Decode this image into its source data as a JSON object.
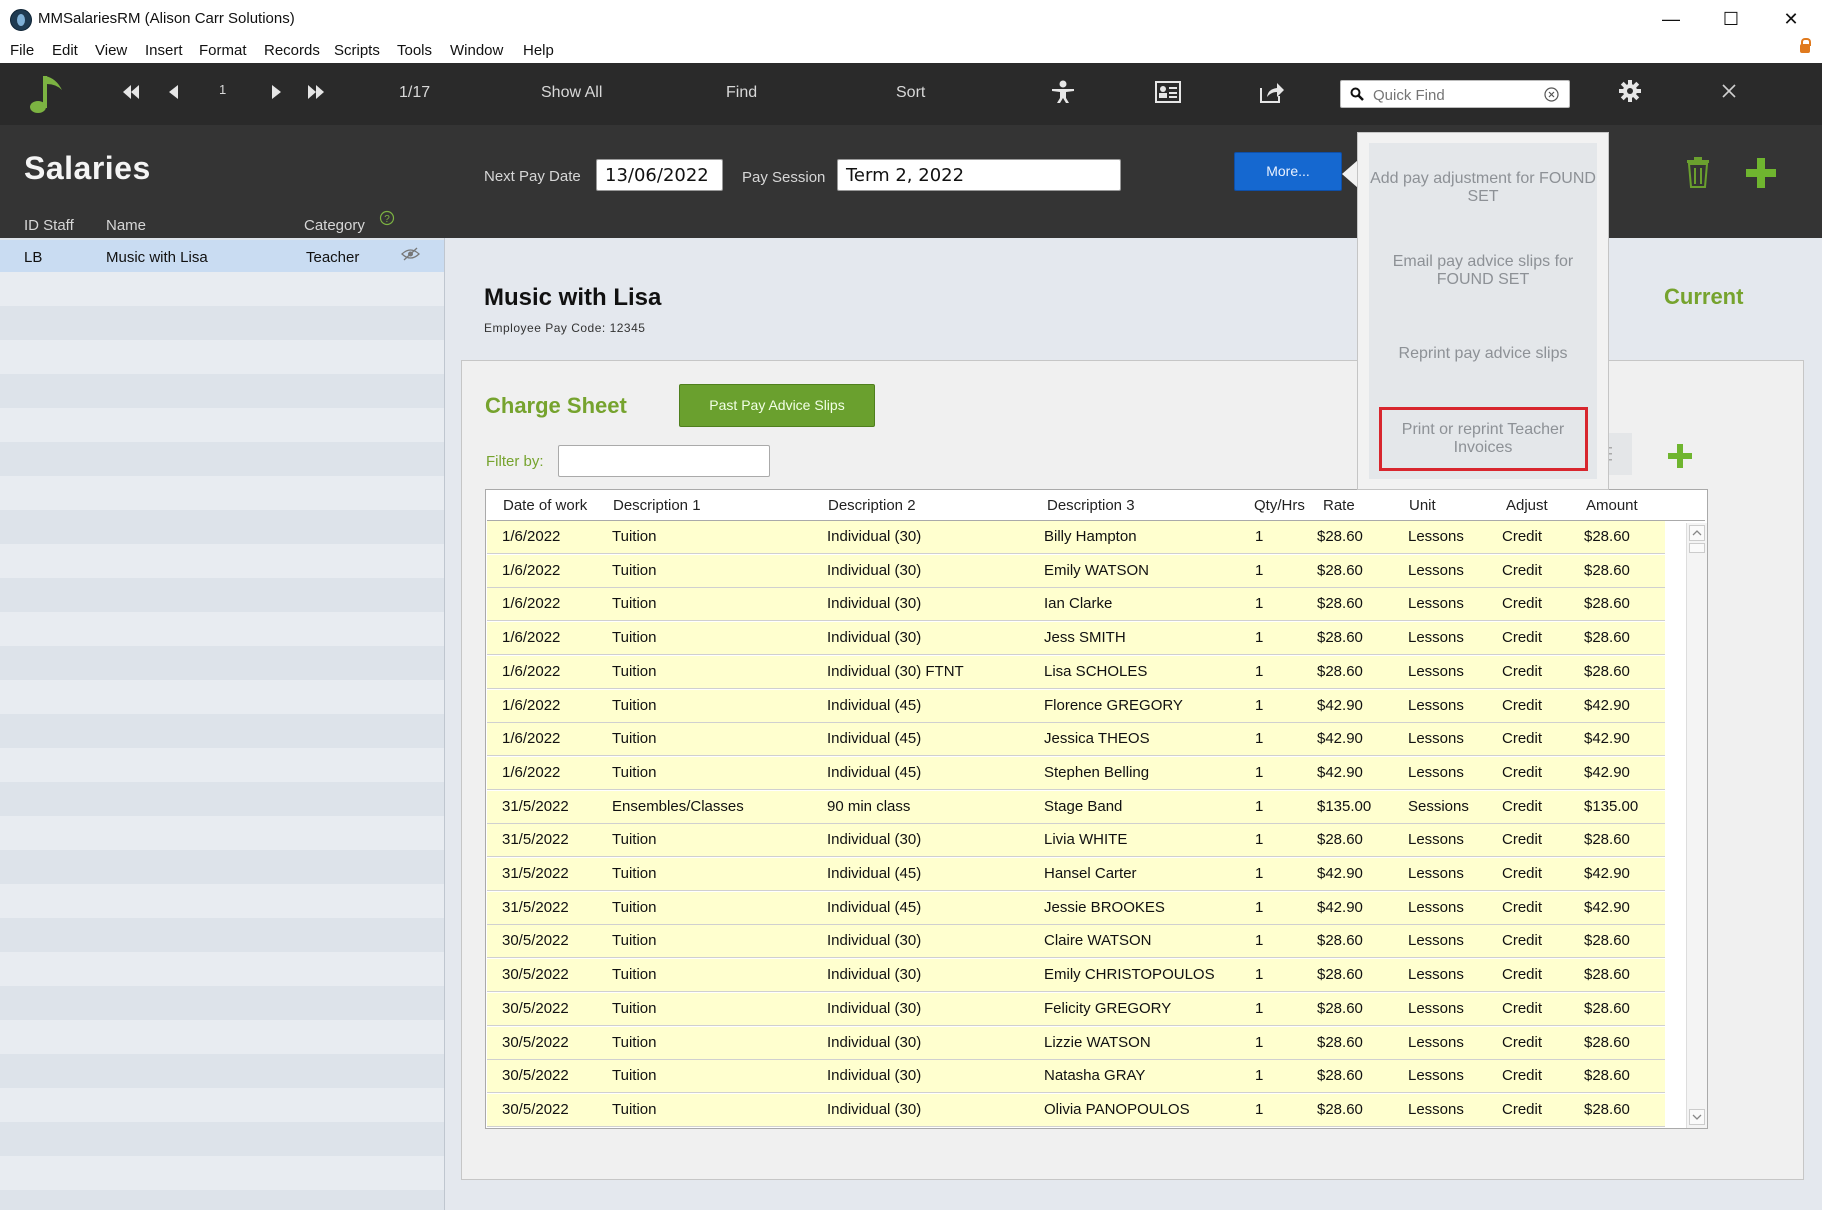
{
  "window": {
    "title": "MMSalariesRM (Alison Carr Solutions)",
    "minimize": "—",
    "maximize": "☐",
    "close": "✕"
  },
  "menu": [
    "File",
    "Edit",
    "View",
    "Insert",
    "Format",
    "Records",
    "Scripts",
    "Tools",
    "Window",
    "Help"
  ],
  "toolbar": {
    "record_number": "1",
    "record_count": "1/17",
    "show_all": "Show All",
    "find": "Find",
    "sort": "Sort",
    "quick_find_placeholder": "Quick Find"
  },
  "header": {
    "title": "Salaries",
    "next_pay_date_label": "Next Pay Date",
    "next_pay_date": "13/06/2022",
    "pay_session_label": "Pay Session",
    "pay_session": "Term 2, 2022",
    "more_label": "More..."
  },
  "list": {
    "columns": [
      "ID Staff",
      "Name",
      "Category"
    ],
    "rows": [
      {
        "id": "LB",
        "name": "Music with Lisa",
        "category": "Teacher"
      }
    ]
  },
  "employee": {
    "name": "Music with Lisa",
    "pay_code": "Employee Pay Code: 12345",
    "status": "Current"
  },
  "charge_sheet": {
    "title": "Charge Sheet",
    "past_slips_label": "Past Pay Advice Slips",
    "filter_label": "Filter by:",
    "filter_value": "",
    "columns": [
      "Date of work",
      "Description 1",
      "Description 2",
      "Description 3",
      "Qty/Hrs",
      "Rate",
      "Unit",
      "Adjust",
      "Amount"
    ],
    "rows": [
      [
        "1/6/2022",
        "Tuition",
        "Individual (30)",
        "Billy Hampton",
        "1",
        "$28.60",
        "Lessons",
        "Credit",
        "$28.60"
      ],
      [
        "1/6/2022",
        "Tuition",
        "Individual (30)",
        "Emily WATSON",
        "1",
        "$28.60",
        "Lessons",
        "Credit",
        "$28.60"
      ],
      [
        "1/6/2022",
        "Tuition",
        "Individual (30)",
        "Ian Clarke",
        "1",
        "$28.60",
        "Lessons",
        "Credit",
        "$28.60"
      ],
      [
        "1/6/2022",
        "Tuition",
        "Individual (30)",
        "Jess SMITH",
        "1",
        "$28.60",
        "Lessons",
        "Credit",
        "$28.60"
      ],
      [
        "1/6/2022",
        "Tuition",
        "Individual (30) FTNT",
        "Lisa SCHOLES",
        "1",
        "$28.60",
        "Lessons",
        "Credit",
        "$28.60"
      ],
      [
        "1/6/2022",
        "Tuition",
        "Individual (45)",
        "Florence GREGORY",
        "1",
        "$42.90",
        "Lessons",
        "Credit",
        "$42.90"
      ],
      [
        "1/6/2022",
        "Tuition",
        "Individual (45)",
        "Jessica THEOS",
        "1",
        "$42.90",
        "Lessons",
        "Credit",
        "$42.90"
      ],
      [
        "1/6/2022",
        "Tuition",
        "Individual (45)",
        "Stephen Belling",
        "1",
        "$42.90",
        "Lessons",
        "Credit",
        "$42.90"
      ],
      [
        "31/5/2022",
        "Ensembles/Classes",
        "90 min class",
        "Stage Band",
        "1",
        "$135.00",
        "Sessions",
        "Credit",
        "$135.00"
      ],
      [
        "31/5/2022",
        "Tuition",
        "Individual (30)",
        "Livia WHITE",
        "1",
        "$28.60",
        "Lessons",
        "Credit",
        "$28.60"
      ],
      [
        "31/5/2022",
        "Tuition",
        "Individual (45)",
        "Hansel Carter",
        "1",
        "$42.90",
        "Lessons",
        "Credit",
        "$42.90"
      ],
      [
        "31/5/2022",
        "Tuition",
        "Individual (45)",
        "Jessie BROOKES",
        "1",
        "$42.90",
        "Lessons",
        "Credit",
        "$42.90"
      ],
      [
        "30/5/2022",
        "Tuition",
        "Individual (30)",
        "Claire WATSON",
        "1",
        "$28.60",
        "Lessons",
        "Credit",
        "$28.60"
      ],
      [
        "30/5/2022",
        "Tuition",
        "Individual (30)",
        "Emily CHRISTOPOULOS",
        "1",
        "$28.60",
        "Lessons",
        "Credit",
        "$28.60"
      ],
      [
        "30/5/2022",
        "Tuition",
        "Individual (30)",
        "Felicity GREGORY",
        "1",
        "$28.60",
        "Lessons",
        "Credit",
        "$28.60"
      ],
      [
        "30/5/2022",
        "Tuition",
        "Individual (30)",
        "Lizzie WATSON",
        "1",
        "$28.60",
        "Lessons",
        "Credit",
        "$28.60"
      ],
      [
        "30/5/2022",
        "Tuition",
        "Individual (30)",
        "Natasha GRAY",
        "1",
        "$28.60",
        "Lessons",
        "Credit",
        "$28.60"
      ],
      [
        "30/5/2022",
        "Tuition",
        "Individual (30)",
        "Olivia PANOPOULOS",
        "1",
        "$28.60",
        "Lessons",
        "Credit",
        "$28.60"
      ]
    ]
  },
  "more_menu": {
    "items": [
      "Add pay adjustment for FOUND SET",
      "Email pay advice slips for FOUND SET",
      "Reprint pay advice slips",
      "Print or reprint Teacher Invoices"
    ],
    "highlighted_index": 3
  },
  "colors": {
    "accent_green": "#76a32e",
    "button_blue": "#1568d0",
    "highlight_red": "#d8262e",
    "row_yellow": "#ffffcf"
  },
  "icons": [
    "music-note-icon",
    "first-record-icon",
    "prev-record-icon",
    "next-record-icon",
    "last-record-icon",
    "person-icon",
    "contact-card-icon",
    "share-icon",
    "search-icon",
    "clear-icon",
    "gear-icon",
    "close-icon",
    "help-icon",
    "hidden-eye-icon",
    "trash-icon",
    "plus-icon",
    "lock-icon"
  ]
}
